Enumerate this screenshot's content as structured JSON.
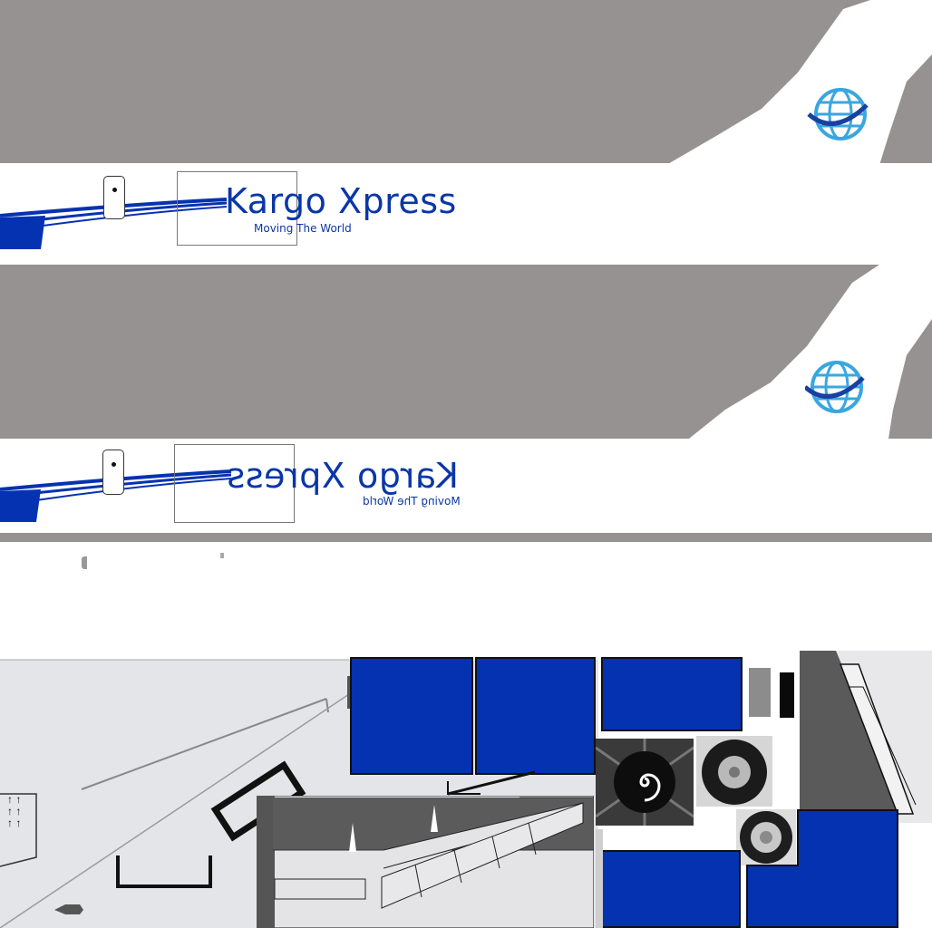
{
  "livery": {
    "brand_name": "Kargo Xpress",
    "slogan": "Moving The World",
    "mirrored_brand_name": "Kargo Xpress",
    "mirrored_slogan": "Moving The World"
  },
  "colors": {
    "fuselage_grey": "#979292",
    "brand_blue": "#0a36a8",
    "panel_blue": "#0532b0",
    "globe_blue": "#3aa6e0",
    "white": "#ffffff"
  },
  "icons": [
    "globe-logo-icon",
    "door-window-icon",
    "arrow-up-icon",
    "tire-icon",
    "engine-spinner-icon"
  ]
}
